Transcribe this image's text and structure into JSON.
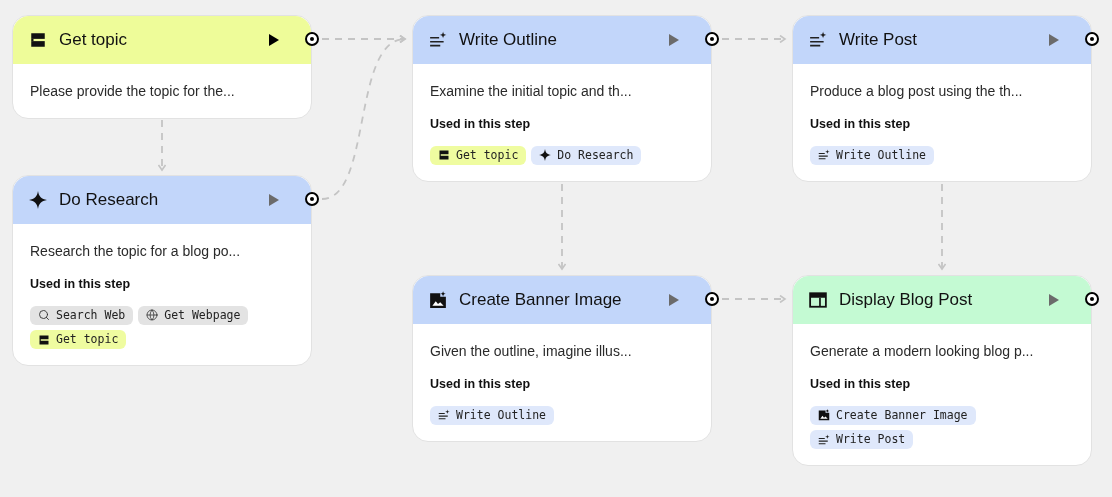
{
  "nodes": [
    {
      "kind": "input",
      "title": "Get topic",
      "run_ready": true,
      "description": "Please provide the topic for the..."
    },
    {
      "kind": "research",
      "title": "Do Research",
      "run_ready": false,
      "description": "Research the topic for a blog po...",
      "used_label": "Used in this step",
      "chips": [
        {
          "kind": "search",
          "label": "Search Web"
        },
        {
          "kind": "web",
          "label": "Get Webpage"
        },
        {
          "kind": "input",
          "label": "Get topic"
        }
      ]
    },
    {
      "kind": "text",
      "title": "Write Outline",
      "run_ready": false,
      "description": "Examine the initial topic and th...",
      "used_label": "Used in this step",
      "chips": [
        {
          "kind": "input",
          "label": "Get topic"
        },
        {
          "kind": "research",
          "label": "Do Research"
        }
      ]
    },
    {
      "kind": "text",
      "title": "Write Post",
      "run_ready": false,
      "description": "Produce a blog post using the th...",
      "used_label": "Used in this step",
      "chips": [
        {
          "kind": "text",
          "label": "Write Outline"
        }
      ]
    },
    {
      "kind": "image",
      "title": "Create Banner Image",
      "run_ready": false,
      "description": "Given the outline, imagine illus...",
      "used_label": "Used in this step",
      "chips": [
        {
          "kind": "text",
          "label": "Write Outline"
        }
      ]
    },
    {
      "kind": "output",
      "title": "Display Blog Post",
      "run_ready": false,
      "description": "Generate a modern looking blog p...",
      "used_label": "Used in this step",
      "chips": [
        {
          "kind": "image",
          "label": "Create Banner Image"
        },
        {
          "kind": "text",
          "label": "Write Post"
        }
      ]
    }
  ]
}
